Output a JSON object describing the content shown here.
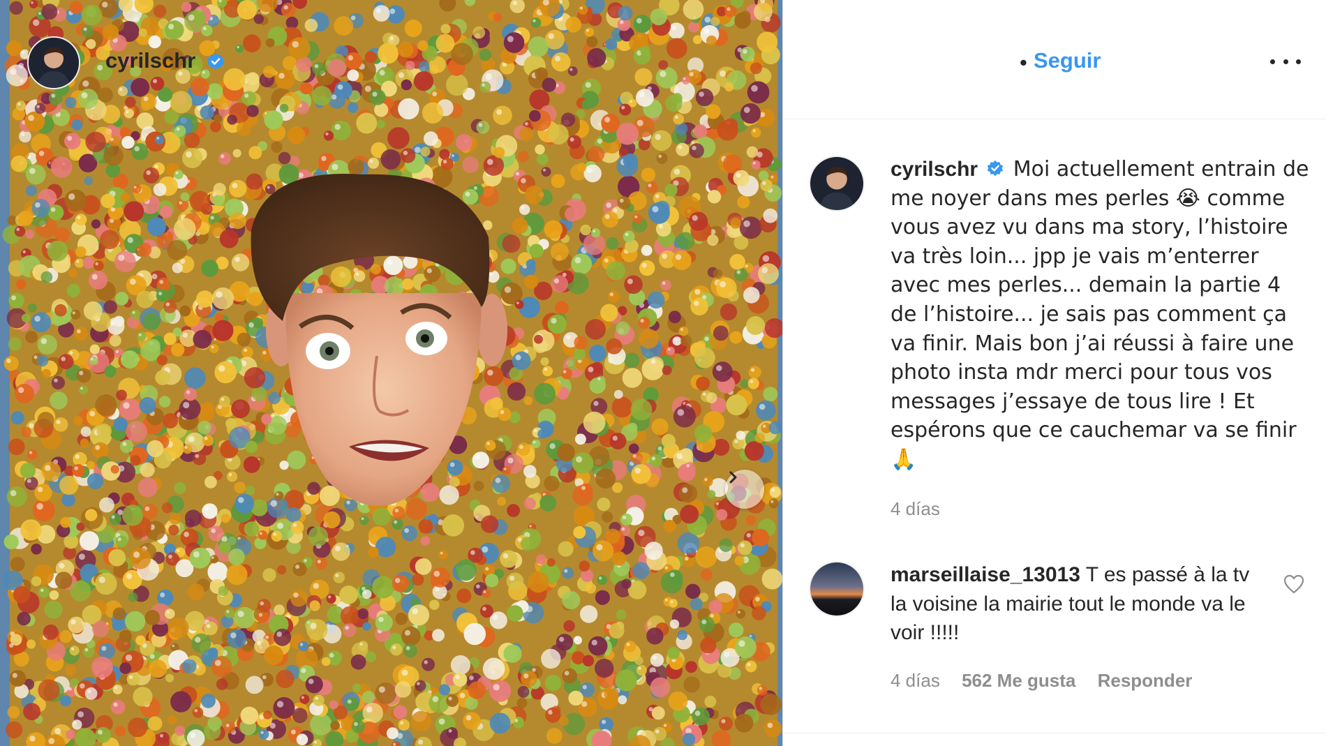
{
  "post": {
    "username": "cyrilschr",
    "follow_label": "Seguir",
    "separator": "•",
    "caption_text": "Moi actuellement entrain de me noyer dans mes perles 😭 comme vous avez vu dans ma story, l’histoire va très loin... jpp je vais m’enterrer avec mes perles... demain la partie 4 de l’histoire... je sais pas comment ça va finir. Mais bon j’ai réussi à faire une photo insta mdr merci pour tous vos messages j’essaye de tous lire ! Et espérons que ce cauchemar va se finir 🙏",
    "caption_time": "4 días",
    "icons": {
      "verified": "verified-badge-icon",
      "more": "more-options-icon",
      "next": "chevron-right-icon",
      "like": "heart-icon"
    }
  },
  "comment": {
    "username": "marseillaise_13013",
    "text": "T es passé à la tv la voisine la mairie tout le monde va le voir !!!!!",
    "time": "4 días",
    "likes": "562 Me gusta",
    "reply_label": "Responder"
  },
  "colors": {
    "link": "#3897f0",
    "verified": "#3897f0",
    "muted": "#8e8e8e",
    "text": "#262626"
  }
}
